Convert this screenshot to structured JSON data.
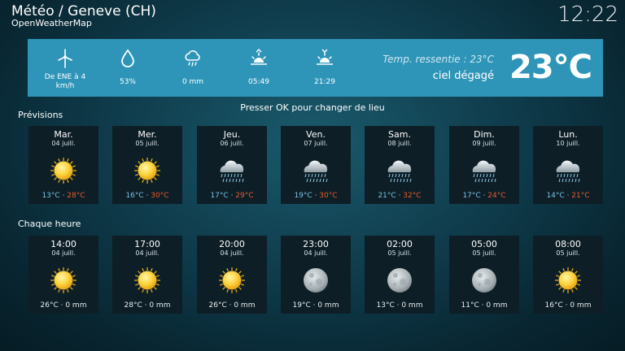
{
  "header": {
    "title": "Météo / Geneve (CH)",
    "provider": "OpenWeatherMap",
    "clock": "12:22"
  },
  "current": {
    "wind": "De ENE à 4 km/h",
    "humidity": "53%",
    "precipitation": "0 mm",
    "sunrise": "05:49",
    "sunset": "21:29",
    "feels_like": "Temp. ressentie : 23°C",
    "condition": "ciel dégagé",
    "temperature": "23°C",
    "icons": [
      "wind-turbine-icon",
      "humidity-drop-icon",
      "rain-cloud-icon",
      "sunrise-icon",
      "sunset-icon"
    ]
  },
  "hint": "Presser OK pour changer de lieu",
  "forecast": {
    "label": "Prévisions",
    "days": [
      {
        "day": "Mar.",
        "date": "04 juill.",
        "icon": "sun-icon",
        "low": "13°C",
        "high": "28°C"
      },
      {
        "day": "Mer.",
        "date": "05 juill.",
        "icon": "sun-icon",
        "low": "16°C",
        "high": "30°C"
      },
      {
        "day": "Jeu.",
        "date": "06 juill.",
        "icon": "rain-cloud-icon",
        "low": "17°C",
        "high": "29°C"
      },
      {
        "day": "Ven.",
        "date": "07 juill.",
        "icon": "rain-cloud-icon",
        "low": "19°C",
        "high": "30°C"
      },
      {
        "day": "Sam.",
        "date": "08 juill.",
        "icon": "rain-cloud-icon",
        "low": "21°C",
        "high": "32°C"
      },
      {
        "day": "Dim.",
        "date": "09 juill.",
        "icon": "rain-cloud-icon",
        "low": "17°C",
        "high": "24°C"
      },
      {
        "day": "Lun.",
        "date": "10 juill.",
        "icon": "rain-cloud-icon",
        "low": "14°C",
        "high": "21°C"
      }
    ]
  },
  "hourly": {
    "label": "Chaque heure",
    "hours": [
      {
        "time": "14:00",
        "date": "04 juill.",
        "icon": "sun-icon",
        "summary": "26°C · 0 mm"
      },
      {
        "time": "17:00",
        "date": "04 juill.",
        "icon": "sun-icon",
        "summary": "28°C · 0 mm"
      },
      {
        "time": "20:00",
        "date": "04 juill.",
        "icon": "sun-icon",
        "summary": "26°C · 0 mm"
      },
      {
        "time": "23:00",
        "date": "04 juill.",
        "icon": "moon-icon",
        "summary": "19°C · 0 mm"
      },
      {
        "time": "02:00",
        "date": "05 juill.",
        "icon": "moon-icon",
        "summary": "13°C · 0 mm"
      },
      {
        "time": "05:00",
        "date": "05 juill.",
        "icon": "moon-icon",
        "summary": "11°C · 0 mm"
      },
      {
        "time": "08:00",
        "date": "05 juill.",
        "icon": "sun-icon",
        "summary": "16°C · 0 mm"
      }
    ]
  },
  "colors": {
    "banner": "#2e95b8",
    "low_temp": "#79c3e6",
    "high_temp": "#e85c2a",
    "card": "#0d1e26"
  }
}
